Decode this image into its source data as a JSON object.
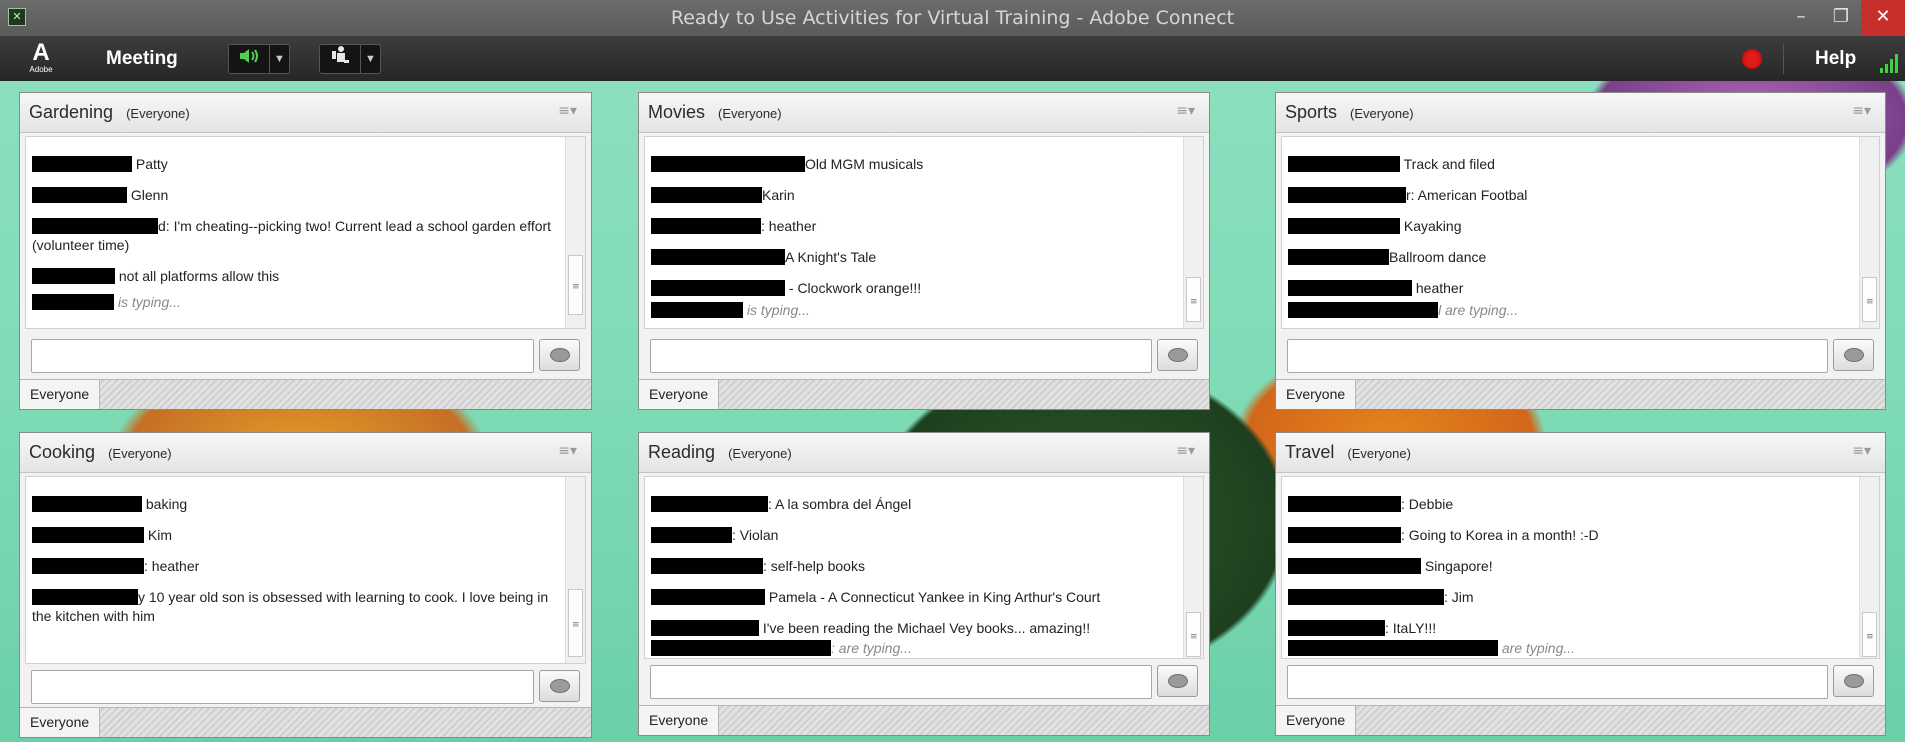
{
  "window": {
    "title": "Ready to Use Activities for Virtual Training - Adobe Connect",
    "app_icon": "adobe-connect-icon"
  },
  "menubar": {
    "logo_letter": "A",
    "logo_word": "Adobe",
    "meeting_label": "Meeting",
    "help_label": "Help"
  },
  "pods": [
    {
      "title": "Gardening",
      "audience": "(Everyone)",
      "footer_tab": "Everyone",
      "messages": [
        {
          "text": " Patty"
        },
        {
          "text": " Glenn"
        },
        {
          "text": "d: I'm cheating--picking two! Current lead a school garden effort (volunteer time)"
        },
        {
          "text": " not all platforms allow this"
        }
      ],
      "typing": " is typing..."
    },
    {
      "title": "Movies",
      "audience": "(Everyone)",
      "footer_tab": "Everyone",
      "messages": [
        {
          "text": "Old MGM musicals"
        },
        {
          "text": "Karin"
        },
        {
          "text": ": heather"
        },
        {
          "text": "A Knight's Tale"
        },
        {
          "text": " - Clockwork orange!!!"
        }
      ],
      "typing": " is typing..."
    },
    {
      "title": "Sports",
      "audience": "(Everyone)",
      "footer_tab": "Everyone",
      "messages": [
        {
          "text": " Track and filed"
        },
        {
          "text": "r: American Footbal"
        },
        {
          "text": " Kayaking"
        },
        {
          "text": "Ballroom dance"
        },
        {
          "text": " heather"
        }
      ],
      "typing": "l are typing..."
    },
    {
      "title": "Cooking",
      "audience": "(Everyone)",
      "footer_tab": "Everyone",
      "messages": [
        {
          "text": " baking"
        },
        {
          "text": " Kim"
        },
        {
          "text": ": heather"
        },
        {
          "text": "y 10 year old son is obsessed with learning to cook.  I love being in the kitchen with him"
        }
      ],
      "typing": ""
    },
    {
      "title": "Reading",
      "audience": "(Everyone)",
      "footer_tab": "Everyone",
      "messages": [
        {
          "text": ": A la sombra del Ángel"
        },
        {
          "text": ": Violan"
        },
        {
          "text": ": self-help books"
        },
        {
          "text": " Pamela - A Connecticut Yankee in King Arthur's Court"
        },
        {
          "text": " I've been reading the Michael Vey books... amazing!!"
        }
      ],
      "typing": ": are typing..."
    },
    {
      "title": "Travel",
      "audience": "(Everyone)",
      "footer_tab": "Everyone",
      "messages": [
        {
          "text": ": Debbie"
        },
        {
          "text": ": Going to Korea in a month! :-D"
        },
        {
          "text": " Singapore!"
        },
        {
          "text": ": Jim"
        },
        {
          "text": ": ItaLY!!!"
        }
      ],
      "typing": " are typing..."
    }
  ],
  "colors": {
    "titlebar": "#5a5a5a",
    "menubar": "#262626",
    "record": "#e21b1b",
    "speaker_green": "#4fd14f"
  },
  "icons": [
    "adobe-logo-icon",
    "speaker-icon",
    "status-icon",
    "record-icon",
    "signal-icon",
    "pod-menu-icon",
    "send-chat-icon"
  ]
}
